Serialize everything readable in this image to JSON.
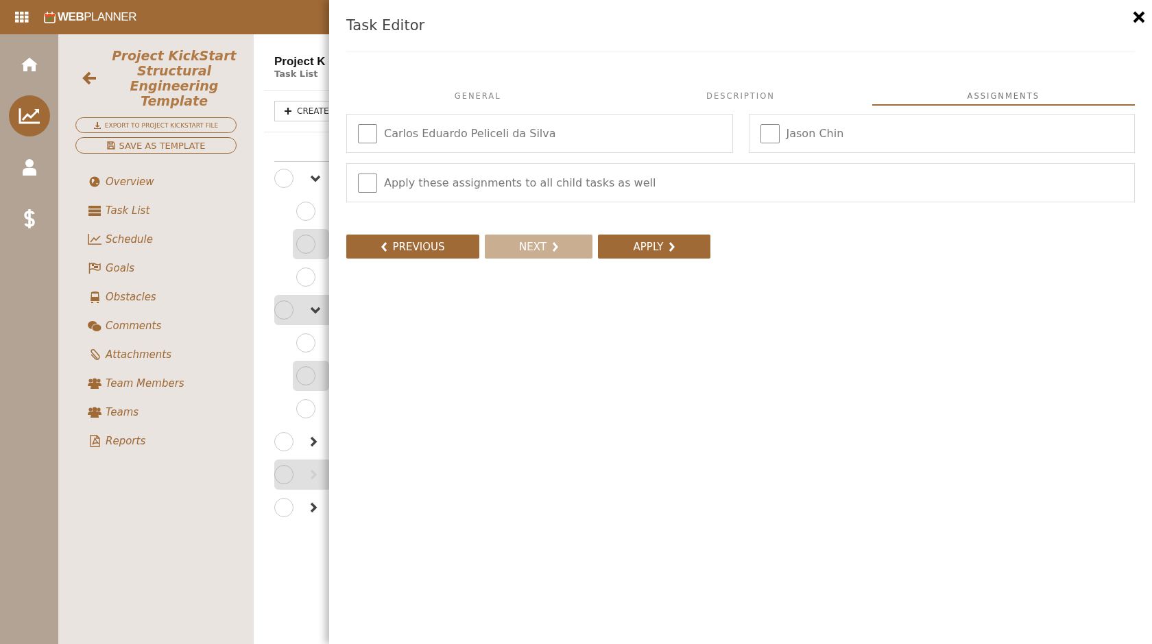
{
  "header": {
    "logo": "**WEB**PLANNER"
  },
  "rail": [
    {
      "kind": "home",
      "selected": false
    },
    {
      "kind": "chart",
      "selected": true
    },
    {
      "kind": "user",
      "selected": false
    },
    {
      "kind": "dollar",
      "selected": false
    }
  ],
  "project": {
    "title": "Project KickStart Structural Engineering Template",
    "actions": [
      {
        "kind": "download",
        "label": "EXPORT TO PROJECT KICKSTART FILE"
      },
      {
        "kind": "save",
        "label": "SAVE AS TEMPLATE"
      }
    ],
    "nav": [
      {
        "kind": "globe",
        "label": "Overview"
      },
      {
        "kind": "list",
        "label": "Task List"
      },
      {
        "kind": "chart",
        "label": "Schedule"
      },
      {
        "kind": "flag",
        "label": "Goals"
      },
      {
        "kind": "bus",
        "label": "Obstacles"
      },
      {
        "kind": "chat",
        "label": "Comments"
      },
      {
        "kind": "clip",
        "label": "Attachments"
      },
      {
        "kind": "people",
        "label": "Team Members"
      },
      {
        "kind": "people",
        "label": "Teams"
      },
      {
        "kind": "pdf",
        "label": "Reports"
      }
    ]
  },
  "main": {
    "title": "Project K",
    "subtitle": "Task List",
    "create_button": "CREATE",
    "tasks": [
      {
        "kind": "parent",
        "expanded": true,
        "shaded": false,
        "faded": false
      },
      {
        "kind": "child",
        "shaded": false
      },
      {
        "kind": "child",
        "shaded": true
      },
      {
        "kind": "child",
        "shaded": false
      },
      {
        "kind": "parent",
        "expanded": true,
        "shaded": true,
        "faded": false
      },
      {
        "kind": "child",
        "shaded": false
      },
      {
        "kind": "child",
        "shaded": true
      },
      {
        "kind": "child",
        "shaded": false
      },
      {
        "kind": "parent",
        "expanded": false,
        "shaded": false,
        "faded": false
      },
      {
        "kind": "parent",
        "expanded": false,
        "shaded": true,
        "faded": true
      },
      {
        "kind": "parent",
        "expanded": false,
        "shaded": false,
        "faded": false
      }
    ]
  },
  "editor": {
    "title": "Task Editor",
    "tabs": [
      {
        "label": "GENERAL",
        "selected": false
      },
      {
        "label": "DESCRIPTION",
        "selected": false
      },
      {
        "label": "ASSIGNMENTS",
        "selected": true
      }
    ],
    "assignees": [
      {
        "name": "Carlos Eduardo Peliceli da Silva",
        "checked": false
      },
      {
        "name": "Jason Chin",
        "checked": false
      }
    ],
    "apply_all": {
      "label": "Apply these assignments to all child tasks as well",
      "checked": false
    },
    "buttons": [
      {
        "kind": "prev",
        "label": "PREVIOUS",
        "disabled": false
      },
      {
        "kind": "next",
        "label": "NEXT",
        "disabled": true
      },
      {
        "kind": "next",
        "label": "APPLY",
        "disabled": false
      }
    ]
  }
}
